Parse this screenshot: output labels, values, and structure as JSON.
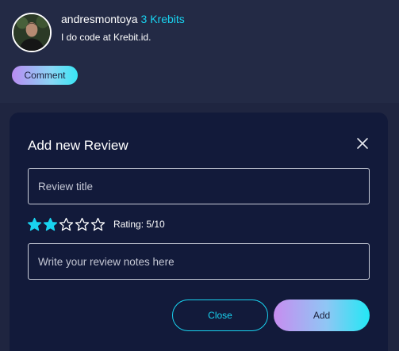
{
  "profile": {
    "username": "andresmontoya",
    "krebits": "3 Krebits",
    "bio": "I do code at Krebit.id.",
    "comment_label": "Comment"
  },
  "modal": {
    "title": "Add new Review",
    "review_title_placeholder": "Review title",
    "rating": {
      "filled": 2,
      "total": 5,
      "label": "Rating: 5/10"
    },
    "notes_placeholder": "Write your review notes here",
    "close_label": "Close",
    "add_label": "Add"
  },
  "colors": {
    "accent": "#19d3f0",
    "modal_bg": "#121a3a",
    "page_bg": "#1f2540"
  }
}
